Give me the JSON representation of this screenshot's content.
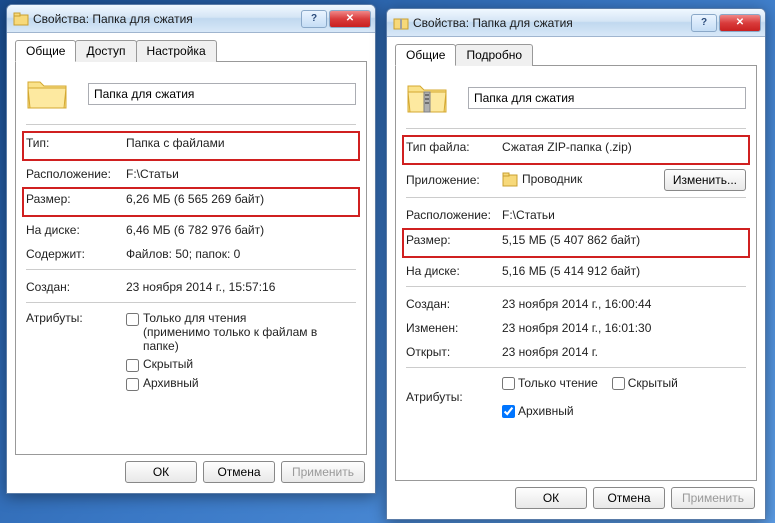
{
  "left": {
    "title": "Свойства: Папка для сжатия",
    "tabs": {
      "general": "Общие",
      "access": "Доступ",
      "settings": "Настройка"
    },
    "name": "Папка для сжатия",
    "type_label": "Тип:",
    "type_value": "Папка с файлами",
    "location_label": "Расположение:",
    "location_value": "F:\\Статьи",
    "size_label": "Размер:",
    "size_value": "6,26 МБ (6 565 269 байт)",
    "diskSize_label": "На диске:",
    "diskSize_value": "6,46 МБ (6 782 976 байт)",
    "contains_label": "Содержит:",
    "contains_value": "Файлов: 50; папок: 0",
    "created_label": "Создан:",
    "created_value": "23 ноября 2014 г., 15:57:16",
    "attrs_label": "Атрибуты:",
    "readonly_label": "Только для чтения",
    "readonly_note": "(применимо только к файлам в папке)",
    "hidden_label": "Скрытый",
    "archive_label": "Архивный",
    "ok": "ОК",
    "cancel": "Отмена",
    "apply": "Применить"
  },
  "right": {
    "title": "Свойства: Папка для сжатия",
    "tabs": {
      "general": "Общие",
      "details": "Подробно"
    },
    "name": "Папка для сжатия",
    "filetype_label": "Тип файла:",
    "filetype_value": "Сжатая ZIP-папка (.zip)",
    "app_label": "Приложение:",
    "app_value": "Проводник",
    "change": "Изменить...",
    "location_label": "Расположение:",
    "location_value": "F:\\Статьи",
    "size_label": "Размер:",
    "size_value": "5,15 МБ (5 407 862 байт)",
    "diskSize_label": "На диске:",
    "diskSize_value": "5,16 МБ (5 414 912 байт)",
    "created_label": "Создан:",
    "created_value": "23 ноября 2014 г., 16:00:44",
    "modified_label": "Изменен:",
    "modified_value": "23 ноября 2014 г., 16:01:30",
    "opened_label": "Открыт:",
    "opened_value": "23 ноября 2014 г.",
    "attrs_label": "Атрибуты:",
    "readonly_label": "Только чтение",
    "hidden_label": "Скрытый",
    "archive_label": "Архивный",
    "ok": "ОК",
    "cancel": "Отмена",
    "apply": "Применить"
  }
}
